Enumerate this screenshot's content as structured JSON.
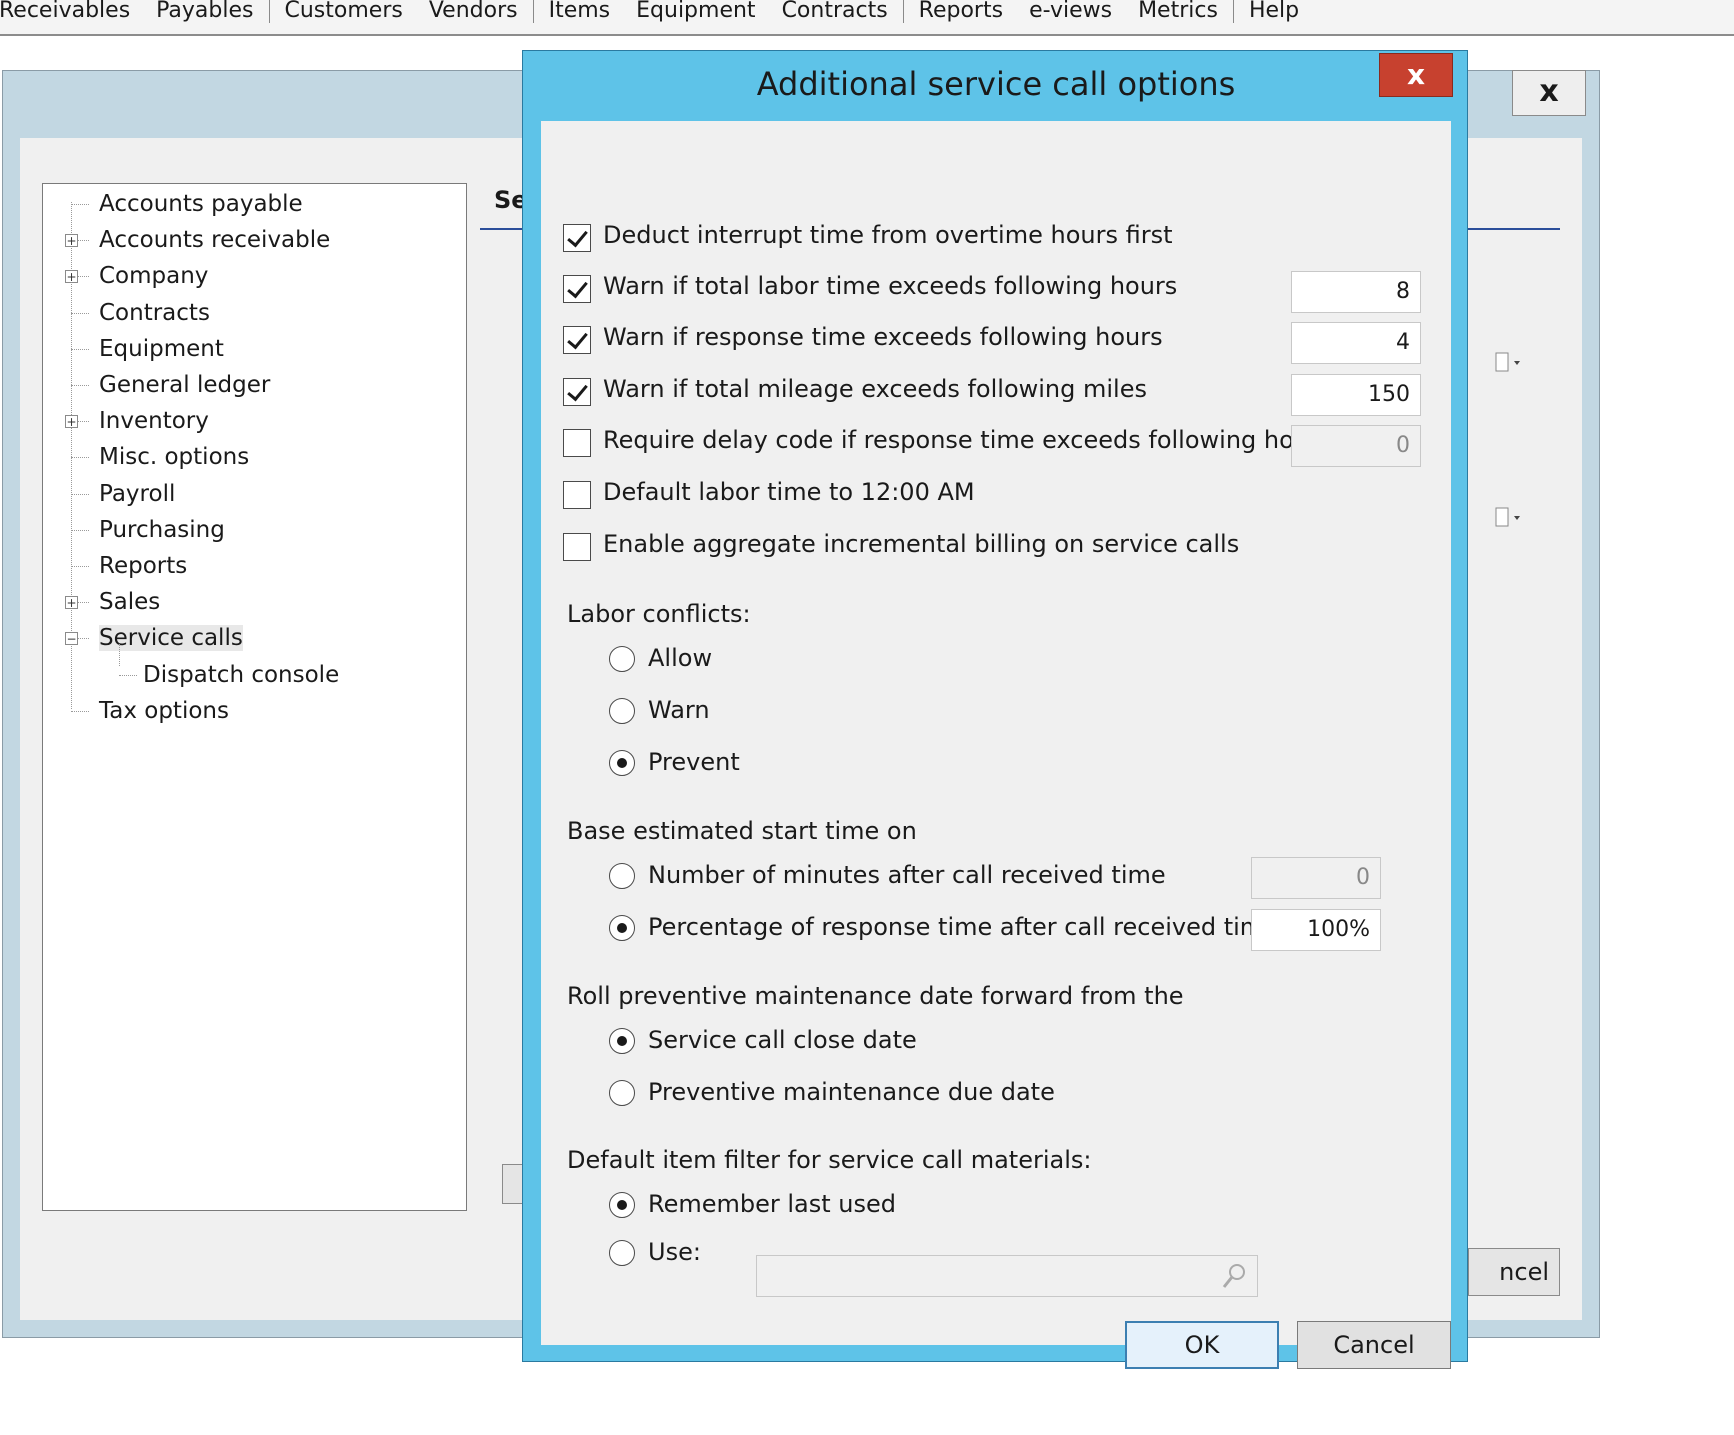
{
  "menubar": {
    "items": [
      "Receivables",
      "Payables",
      "Customers",
      "Vendors",
      "Items",
      "Equipment",
      "Contracts",
      "Reports",
      "e-views",
      "Metrics",
      "Help"
    ]
  },
  "background_window": {
    "close_label": "x",
    "tab_label": "Se",
    "cancel_label": "ncel",
    "tree": [
      {
        "label": "Accounts payable",
        "expandable": false
      },
      {
        "label": "Accounts receivable",
        "expandable": true,
        "expand_symbol": "+"
      },
      {
        "label": "Company",
        "expandable": true,
        "expand_symbol": "+"
      },
      {
        "label": "Contracts",
        "expandable": false
      },
      {
        "label": "Equipment",
        "expandable": false
      },
      {
        "label": "General ledger",
        "expandable": false
      },
      {
        "label": "Inventory",
        "expandable": true,
        "expand_symbol": "+"
      },
      {
        "label": "Misc. options",
        "expandable": false
      },
      {
        "label": "Payroll",
        "expandable": false
      },
      {
        "label": "Purchasing",
        "expandable": false
      },
      {
        "label": "Reports",
        "expandable": false
      },
      {
        "label": "Sales",
        "expandable": true,
        "expand_symbol": "+"
      },
      {
        "label": "Service calls",
        "expandable": true,
        "expand_symbol": "−",
        "selected": true
      },
      {
        "label": "Dispatch console",
        "child": true
      },
      {
        "label": "Tax options",
        "expandable": false
      }
    ]
  },
  "dialog": {
    "title": "Additional service call options",
    "close_label": "x",
    "checkboxes": [
      {
        "label": "Deduct interrupt time from overtime hours first",
        "checked": true
      },
      {
        "label": "Warn if total labor time exceeds following hours",
        "checked": true,
        "value": "8"
      },
      {
        "label": "Warn if response time exceeds following hours",
        "checked": true,
        "value": "4"
      },
      {
        "label": "Warn if total mileage exceeds following miles",
        "checked": true,
        "value": "150"
      },
      {
        "label": "Require delay code if response time exceeds following hours",
        "checked": false,
        "value": "0",
        "disabled": true
      },
      {
        "label": "Default labor time to 12:00 AM",
        "checked": false
      },
      {
        "label": "Enable aggregate incremental billing on service calls",
        "checked": false
      }
    ],
    "labor_conflicts": {
      "heading": "Labor conflicts:",
      "options": [
        "Allow",
        "Warn",
        "Prevent"
      ],
      "selected": "Prevent"
    },
    "estimated_start": {
      "heading": "Base estimated start time on",
      "options": [
        {
          "label": "Number of minutes after call received time",
          "value": "0",
          "disabled": true
        },
        {
          "label": "Percentage of response time after call received time",
          "value": "100%"
        }
      ],
      "selected_index": 1
    },
    "roll_pm": {
      "heading": "Roll preventive maintenance date forward from the",
      "options": [
        "Service call close date",
        "Preventive maintenance due date"
      ],
      "selected_index": 0
    },
    "item_filter": {
      "heading": "Default item filter for service call materials:",
      "options": [
        "Remember last used",
        "Use:"
      ],
      "selected_index": 0,
      "use_value": ""
    },
    "buttons": {
      "ok": "OK",
      "cancel": "Cancel"
    }
  }
}
